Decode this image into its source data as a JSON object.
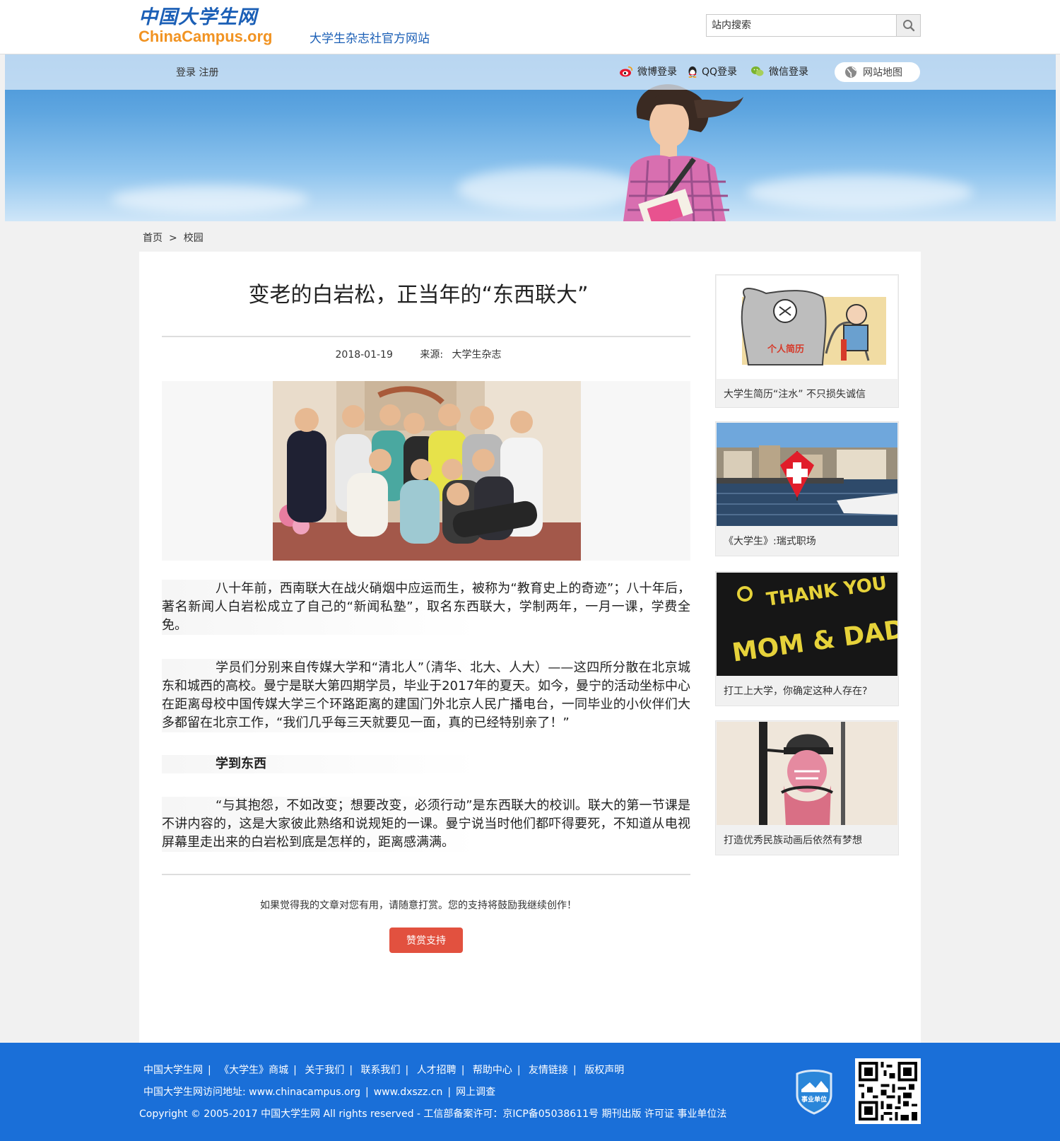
{
  "header": {
    "logo_cn": "中国大学生网",
    "logo_en": "ChinaCampus.org",
    "slogan": "大学生杂志社官方网站",
    "search_placeholder": "站内搜索"
  },
  "nav": {
    "login": "登录",
    "register": "注册",
    "weibo": "微博登录",
    "qq": "QQ登录",
    "wechat": "微信登录",
    "sitemap": "网站地图"
  },
  "breadcrumb": {
    "home": "首页",
    "sep": ">",
    "current": "校园"
  },
  "article": {
    "title": "变老的白岩松，正当年的“东西联大”",
    "date": "2018-01-19",
    "source_label": "来源:",
    "source": "大学生杂志",
    "paragraphs": [
      "八十年前，西南联大在战火硝烟中应运而生，被称为“教育史上的奇迹”；八十年后，著名新闻人白岩松成立了自己的“新闻私塾”，取名东西联大，学制两年，一月一课，学费全免。",
      "学员们分别来自传媒大学和“清北人”（清华、北大、人大）——这四所分散在北京城东和城西的高校。曼宁是联大第四期学员，毕业于2017年的夏天。如今，曼宁的活动坐标中心在距离母校中国传媒大学三个环路距离的建国门外北京人民广播电台，一同毕业的小伙伴们大多都留在北京工作，“我们几乎每三天就要见一面，真的已经特别亲了！”",
      "“与其抱怨，不如改变；想要改变，必须行动”是东西联大的校训。联大的第一节课是不讲内容的，这是大家彼此熟络和说规矩的一课。曼宁说当时他们都吓得要死，不知道从电视屏幕里走出来的白岩松到底是怎样的，距离感满满。"
    ],
    "subhead": "学到东西",
    "reward_text": "如果觉得我的文章对您有用，请随意打赏。您的支持将鼓励我继续创作！",
    "reward_button": "赞赏支持"
  },
  "sidebar": [
    {
      "caption": "大学生简历“注水” 不只损失诚信",
      "thumb_text": "个人简历"
    },
    {
      "caption": "《大学生》:瑞式职场"
    },
    {
      "caption": "打工上大学，你确定这种人存在?",
      "thumb_text_1": "THANK YOU",
      "thumb_text_2": "MOM & DAD"
    },
    {
      "caption": "打造优秀民族动画后依然有梦想"
    }
  ],
  "footer": {
    "links": [
      "中国大学生网",
      "《大学生》商城",
      "关于我们",
      "联系我们",
      "人才招聘",
      "帮助中心",
      "友情链接",
      "版权声明"
    ],
    "address_label": "中国大学生网访问地址:",
    "address_1": "www.chinacampus.org",
    "address_2": "www.dxszz.cn",
    "survey": "网上调查",
    "copyright": "Copyright © 2005-2017   中国大学生网 All rights reserved - 工信部备案许可：京ICP备05038611号 期刊出版 许可证 事业单位法",
    "badge_text": "事业单位"
  },
  "colors": {
    "brand_blue": "#1b5fb6",
    "logo_orange": "#f19322",
    "footer_blue": "#1a6fd8",
    "reward_red": "#e2513f"
  }
}
